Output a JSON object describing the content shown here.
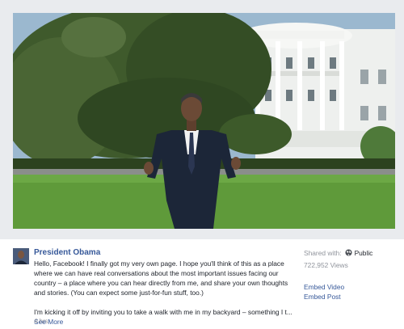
{
  "post": {
    "author": "President Obama",
    "paragraph_1": "Hello, Facebook! I finally got my very own page. I hope you'll think of this as a place where we can have real conversations about the most important issues facing our country – a place where you can hear directly from me, and share your own thoughts and stories. (You can expect some just-for-fun stuff, too.)",
    "paragraph_2": "I'm kicking it off by inviting you to take a walk with me in my backyard – something I t...",
    "see_more": "See More",
    "timestamp": "4 hrs"
  },
  "sidebar": {
    "shared_with_label": "Shared with:",
    "privacy": "Public",
    "views": "722,952 Views",
    "embed_video": "Embed Video",
    "embed_post": "Embed Post"
  },
  "icons": {
    "privacy_icon": "globe-icon"
  },
  "colors": {
    "link": "#365899",
    "text": "#1d2129",
    "muted": "#90949c",
    "page_background": "#e9ebee"
  }
}
